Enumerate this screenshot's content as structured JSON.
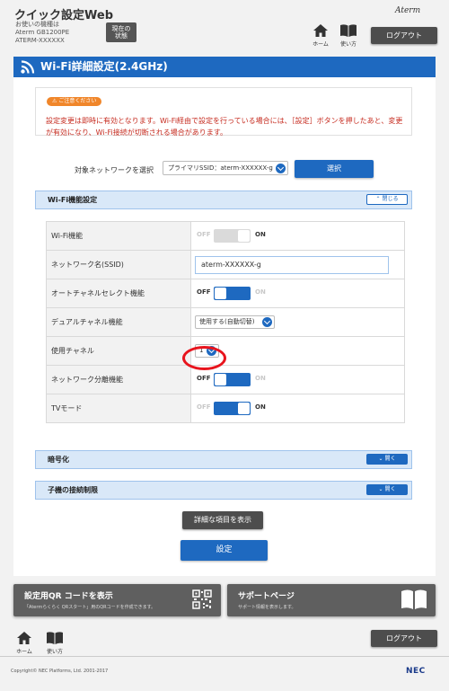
{
  "header": {
    "app_title": "クイック設定Web",
    "device_info": [
      "お使いの機種は",
      "Aterm GB1200PE",
      "ATERM-XXXXXX"
    ],
    "status_button": [
      "現在の",
      "状態"
    ],
    "brand_logo": "Aterm",
    "home_label": "ホーム",
    "manual_label": "使い方",
    "logout_label": "ログアウト"
  },
  "title_bar": {
    "title": "Wi-Fi詳細設定(2.4GHz)",
    "color": "#1e69c0"
  },
  "notice": {
    "badge": "ご注意ください",
    "text": "設定変更は即時に有効となります。Wi-Fi経由で設定を行っている場合には、［設定］ボタンを押したあと、変更が有効になり、Wi-Fi接続が切断される場合があります。",
    "text_color": "#c62b1f"
  },
  "network_selector": {
    "label": "対象ネットワークを選択",
    "selected": "プライマリSSID：aterm-XXXXXX-g",
    "button": "選択"
  },
  "wifi_section": {
    "title": "Wi-Fi機能設定",
    "toggle": "閉じる"
  },
  "settings": [
    {
      "label": "Wi-Fi機能",
      "type": "switch",
      "state": "ON",
      "disabled": true
    },
    {
      "label": "ネットワーク名(SSID)",
      "type": "text",
      "value": "aterm-XXXXXX-g"
    },
    {
      "label": "オートチャネルセレクト機能",
      "type": "switch",
      "state": "OFF",
      "disabled": false
    },
    {
      "label": "デュアルチャネル機能",
      "type": "select",
      "value": "使用する(自動切替)"
    },
    {
      "label": "使用チャネル",
      "type": "select",
      "value": "1",
      "highlighted": true
    },
    {
      "label": "ネットワーク分離機能",
      "type": "switch",
      "state": "OFF",
      "disabled": false
    },
    {
      "label": "TVモード",
      "type": "switch",
      "state": "ON",
      "disabled": false
    }
  ],
  "switch_text": {
    "off": "OFF",
    "on": "ON"
  },
  "encryption_section": {
    "title": "暗号化",
    "toggle": "開く"
  },
  "access_control_section": {
    "title": "子機の接続制限",
    "toggle": "開く"
  },
  "detail_button": "詳細な項目を表示",
  "set_button": "設定",
  "footer_cards": {
    "qr": {
      "title": "設定用QR コードを表示",
      "subtitle": "「Atermらくらく QRスタート」用のQRコードを作成できます。",
      "icon": "qr-code-icon"
    },
    "support": {
      "title": "サポートページ",
      "subtitle": "サポート情報を表示します。",
      "icon": "book-icon"
    }
  },
  "footer": {
    "home_label": "ホーム",
    "manual_label": "使い方",
    "logout_label": "ログアウト",
    "copyright": "Copyright© NEC Platforms, Ltd. 2001-2017",
    "logo": "NEC"
  }
}
